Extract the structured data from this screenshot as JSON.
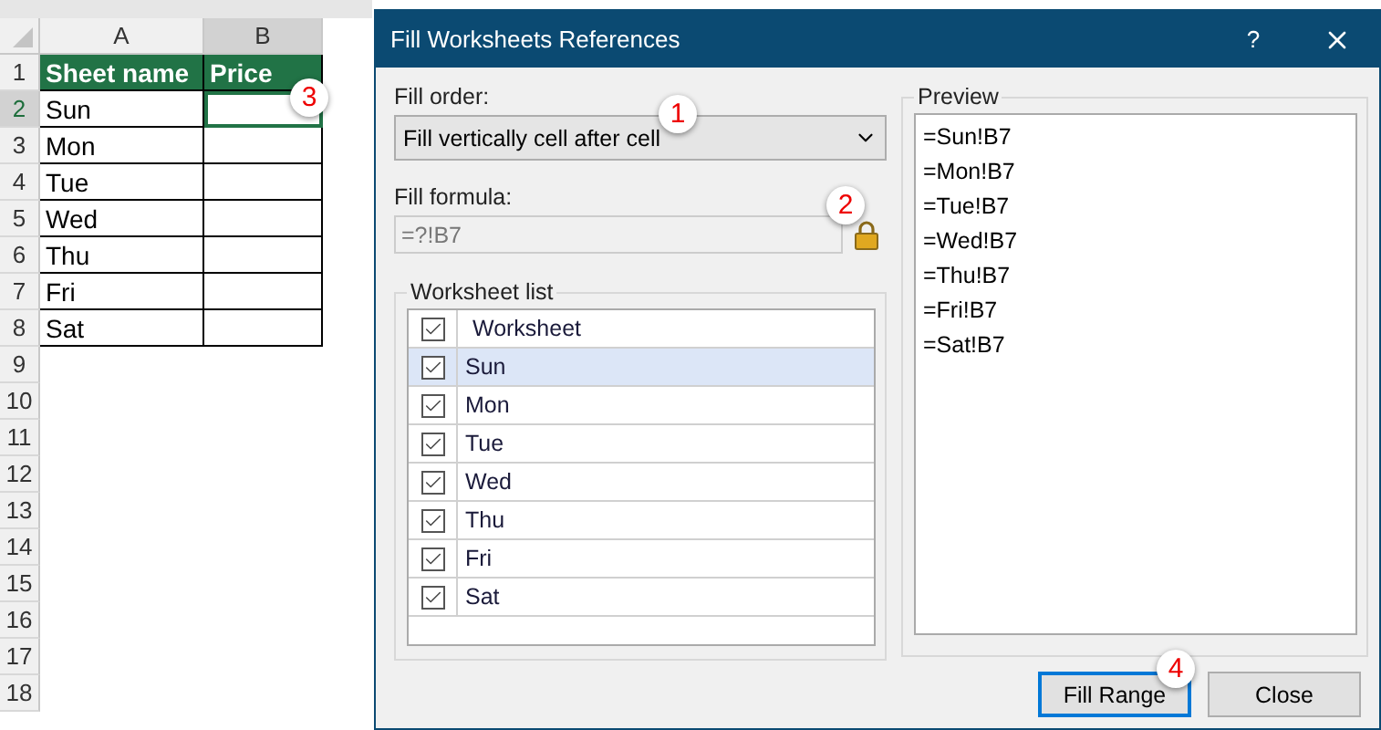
{
  "sheet": {
    "columns": [
      "A",
      "B"
    ],
    "callout": "3",
    "rows": [
      {
        "number": "1",
        "kind": "header",
        "cells": [
          {
            "text": "Sheet name",
            "selected": false
          },
          {
            "text": "Price",
            "selected": false
          }
        ]
      },
      {
        "number": "2",
        "kind": "data",
        "cells": [
          {
            "text": "Sun",
            "selected": false
          },
          {
            "selected": true
          }
        ]
      },
      {
        "number": "3",
        "kind": "data",
        "cells": [
          {
            "text": "Mon",
            "selected": false
          },
          {
            "selected": false
          }
        ]
      },
      {
        "number": "4",
        "kind": "data",
        "cells": [
          {
            "text": "Tue",
            "selected": false
          },
          {
            "selected": false
          }
        ]
      },
      {
        "number": "5",
        "kind": "data",
        "cells": [
          {
            "text": "Wed",
            "selected": false
          },
          {
            "selected": false
          }
        ]
      },
      {
        "number": "6",
        "kind": "data",
        "cells": [
          {
            "text": "Thu",
            "selected": false
          },
          {
            "selected": false
          }
        ]
      },
      {
        "number": "7",
        "kind": "data",
        "cells": [
          {
            "text": "Fri",
            "selected": false
          },
          {
            "selected": false
          }
        ]
      },
      {
        "number": "8",
        "kind": "data",
        "cells": [
          {
            "text": "Sat",
            "selected": false
          },
          {
            "selected": false
          }
        ]
      },
      {
        "number": "9",
        "kind": "empty"
      },
      {
        "number": "10",
        "kind": "empty"
      },
      {
        "number": "11",
        "kind": "empty"
      },
      {
        "number": "12",
        "kind": "empty"
      },
      {
        "number": "13",
        "kind": "empty"
      },
      {
        "number": "14",
        "kind": "empty"
      },
      {
        "number": "15",
        "kind": "empty"
      },
      {
        "number": "16",
        "kind": "empty"
      },
      {
        "number": "17",
        "kind": "empty"
      },
      {
        "number": "18",
        "kind": "empty"
      }
    ]
  },
  "dialog": {
    "title": "Fill Worksheets References",
    "help": "?",
    "fill_order": {
      "label": "Fill order:",
      "value": "Fill vertically cell after cell",
      "callout": "1"
    },
    "fill_formula": {
      "label": "Fill formula:",
      "value": "=?!B7",
      "disabled": true,
      "callout": "2"
    },
    "worksheet_list": {
      "title": "Worksheet list",
      "header": {
        "label": "Worksheet",
        "checked": true
      },
      "items": [
        {
          "label": "Sun",
          "checked": true,
          "selected": true
        },
        {
          "label": "Mon",
          "checked": true,
          "selected": false
        },
        {
          "label": "Tue",
          "checked": true,
          "selected": false
        },
        {
          "label": "Wed",
          "checked": true,
          "selected": false
        },
        {
          "label": "Thu",
          "checked": true,
          "selected": false
        },
        {
          "label": "Fri",
          "checked": true,
          "selected": false
        },
        {
          "label": "Sat",
          "checked": true,
          "selected": false
        }
      ]
    },
    "preview": {
      "title": "Preview",
      "lines": [
        "=Sun!B7",
        "=Mon!B7",
        "=Tue!B7",
        "=Wed!B7",
        "=Thu!B7",
        "=Fri!B7",
        "=Sat!B7"
      ]
    },
    "buttons": [
      {
        "label": "Fill Range",
        "focused": true,
        "callout": "4"
      },
      {
        "label": "Close",
        "focused": false
      }
    ]
  }
}
